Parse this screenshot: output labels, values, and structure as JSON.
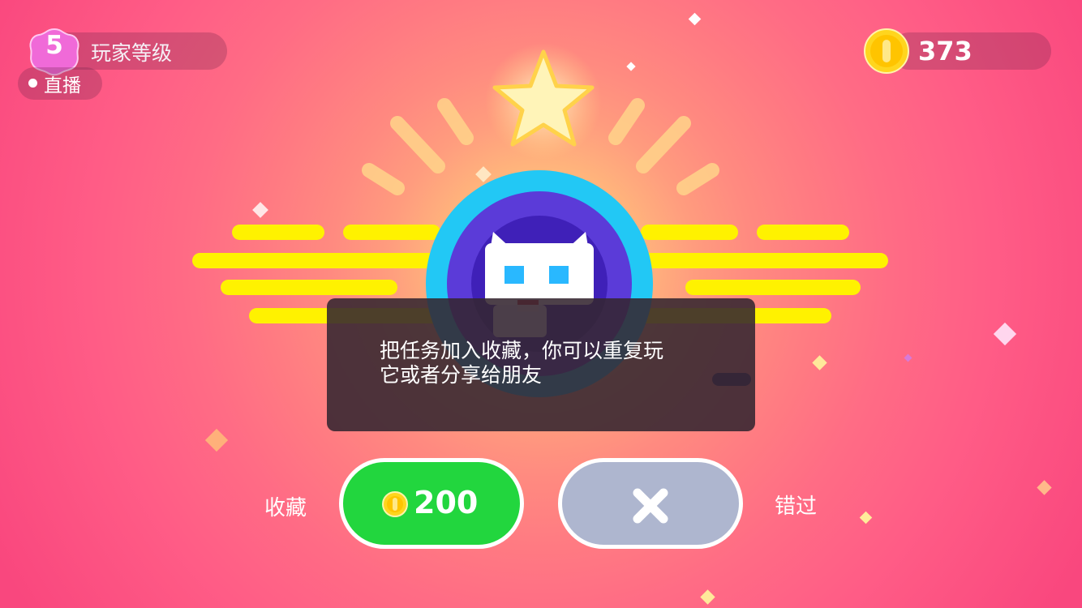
{
  "player": {
    "level": "5",
    "level_label": "玩家等级"
  },
  "live": {
    "label": "直播"
  },
  "coins": {
    "count": "373"
  },
  "tooltip": {
    "line1": "把任务加入收藏，你可以重复玩",
    "line2": "它或者分享给朋友"
  },
  "actions": {
    "save_label": "收藏",
    "save_cost": "200",
    "skip_label": "错过"
  },
  "colors": {
    "save_button": "#22d63e",
    "skip_button": "#aeb6cf",
    "accent_yellow": "#fff200",
    "badge_pink": "#f06ad8",
    "ring_cyan": "#22c8f5",
    "ring_violet": "#5b3bd8"
  },
  "icons": [
    "level-badge-icon",
    "coin-icon",
    "star-icon",
    "cat-character-icon",
    "close-icon"
  ]
}
